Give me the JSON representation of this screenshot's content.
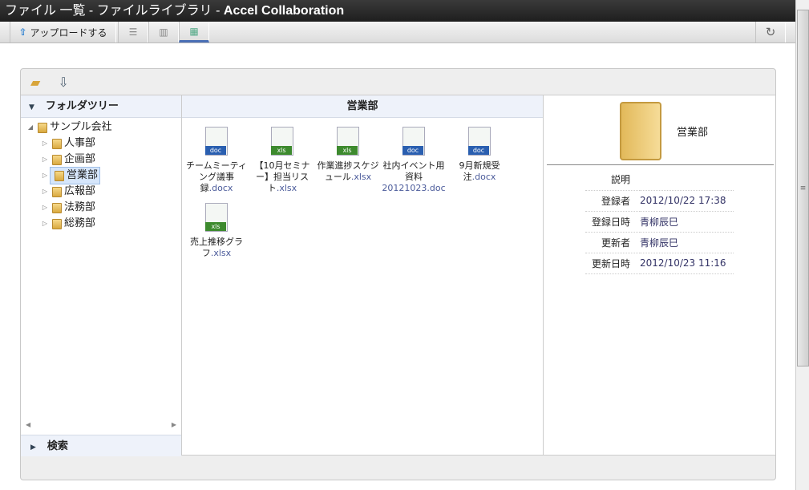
{
  "window": {
    "title_jp": "ファイル 一覧 - ファイルライブラリ - ",
    "title_en": "Accel Collaboration"
  },
  "toolbar": {
    "upload_label": "アップロードする"
  },
  "tree": {
    "header": "フォルダツリー",
    "root": "サンプル会社",
    "children": [
      "人事部",
      "企画部",
      "営業部",
      "広報部",
      "法務部",
      "総務部"
    ],
    "selected_index": 2,
    "search_label": "検索"
  },
  "center": {
    "header": "営業部",
    "files": [
      {
        "type": "doc",
        "name": "チームミーティング議事録",
        "ext": ".docx"
      },
      {
        "type": "xls",
        "name": "【10月セミナー】担当リスト",
        "ext": ".xlsx"
      },
      {
        "type": "xls",
        "name": "作業進捗スケジュール",
        "ext": ".xlsx"
      },
      {
        "type": "doc",
        "name": "社内イベント用資料",
        "ext": "20121023.doc"
      },
      {
        "type": "doc",
        "name": "9月新規受注",
        "ext": ".docx"
      },
      {
        "type": "xls",
        "name": "売上推移グラフ",
        "ext": ".xlsx"
      }
    ]
  },
  "details": {
    "folder_name": "営業部",
    "props": [
      {
        "key": "説明",
        "value": ""
      },
      {
        "key": "登録者",
        "value": "2012/10/22 17:38"
      },
      {
        "key": "登録日時",
        "value": "青柳辰巳"
      },
      {
        "key": "更新者",
        "value": "青柳辰巳"
      },
      {
        "key": "更新日時",
        "value": "2012/10/23 11:16"
      }
    ]
  },
  "colors": {
    "doc": "#2a5fb0",
    "xls": "#3d8a2e",
    "accent": "#4a6fb5"
  }
}
